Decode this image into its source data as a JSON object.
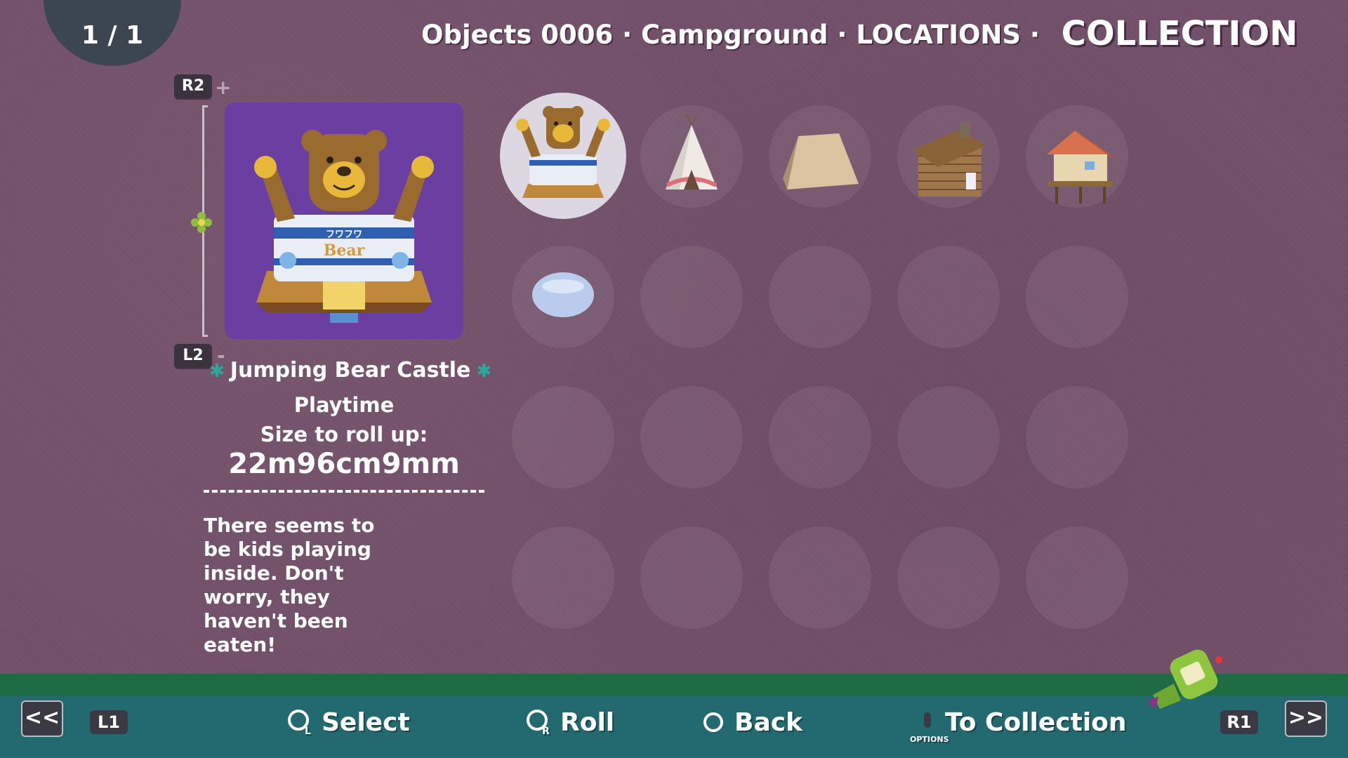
{
  "header": {
    "page_counter": "1 / 1",
    "breadcrumb": "Objects 0006 · Campground · LOCATIONS ·",
    "title": "COLLECTION"
  },
  "zoom": {
    "in_button": "R2",
    "in_symbol": "+",
    "out_button": "L2",
    "out_symbol": "-"
  },
  "detail": {
    "name": "Jumping Bear Castle",
    "category": "Playtime",
    "size_label": "Size to roll up:",
    "size_value": "22m96cm9mm",
    "description": "There seems to be kids playing inside. Don't worry, they haven't been eaten!",
    "preview_sign_top": "フワフワ",
    "preview_sign_bottom": "Bear"
  },
  "grid": {
    "selected_index": 0,
    "items": [
      {
        "icon": "bear-castle-icon",
        "state": "collected"
      },
      {
        "icon": "teepee-icon",
        "state": "collected"
      },
      {
        "icon": "tent-icon",
        "state": "collected"
      },
      {
        "icon": "log-cabin-icon",
        "state": "collected"
      },
      {
        "icon": "stilt-house-icon",
        "state": "collected"
      },
      {
        "icon": "puddle-icon",
        "state": "collected"
      },
      {
        "icon": "empty-slot",
        "state": "locked"
      },
      {
        "icon": "empty-slot",
        "state": "locked"
      },
      {
        "icon": "empty-slot",
        "state": "locked"
      },
      {
        "icon": "empty-slot",
        "state": "locked"
      },
      {
        "icon": "empty-slot",
        "state": "locked"
      },
      {
        "icon": "empty-slot",
        "state": "locked"
      },
      {
        "icon": "empty-slot",
        "state": "locked"
      },
      {
        "icon": "empty-slot",
        "state": "locked"
      },
      {
        "icon": "empty-slot",
        "state": "locked"
      },
      {
        "icon": "empty-slot",
        "state": "locked"
      },
      {
        "icon": "empty-slot",
        "state": "locked"
      },
      {
        "icon": "empty-slot",
        "state": "locked"
      },
      {
        "icon": "empty-slot",
        "state": "locked"
      },
      {
        "icon": "empty-slot",
        "state": "locked"
      }
    ]
  },
  "footer": {
    "prev_page": "<<",
    "next_page": ">>",
    "prev_shoulder": "L1",
    "next_shoulder": "R1",
    "select_label": "Select",
    "roll_label": "Roll",
    "back_label": "Back",
    "to_collection_label": "To Collection",
    "options_label": "OPTIONS"
  },
  "colors": {
    "background": "#725069",
    "preview_bg": "#6a3fa1",
    "footer": "#236a70",
    "star_accent": "#2fa79a"
  }
}
